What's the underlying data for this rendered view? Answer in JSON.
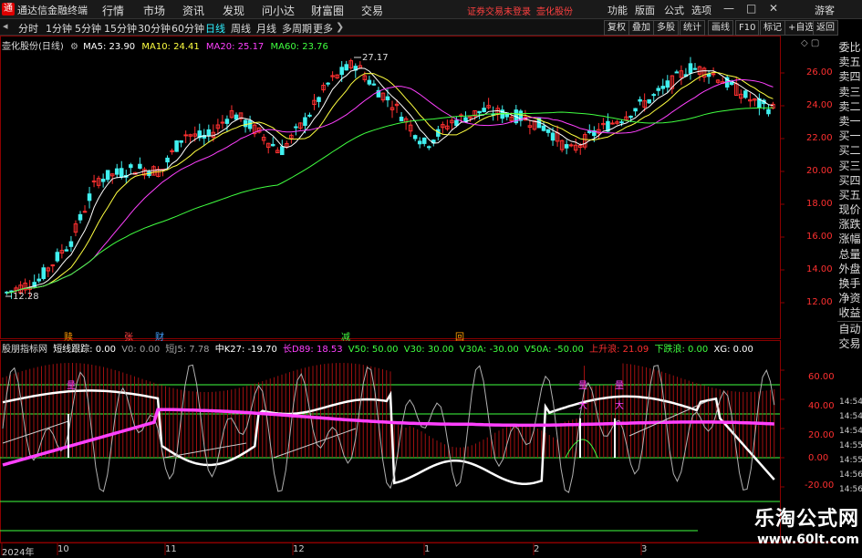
{
  "app": {
    "title": "通达信金融终端",
    "login_warning": "证券交易未登录",
    "stock": "壶化股份",
    "guest": "游客"
  },
  "menu": [
    "行情",
    "市场",
    "资讯",
    "发现",
    "问小达",
    "财富圈",
    "交易"
  ],
  "right_menu": [
    "功能",
    "版面",
    "公式",
    "选项"
  ],
  "toolbar": {
    "periods": [
      "分时",
      "1分钟",
      "5分钟",
      "15分钟",
      "30分钟",
      "60分钟",
      "日线",
      "周线",
      "月线",
      "多周期",
      "更多"
    ],
    "active": "日线"
  },
  "right_toolbar": [
    "复权",
    "叠加",
    "多股",
    "统计",
    "画线",
    "F10",
    "标记",
    "+自选",
    "返回"
  ],
  "main_chart": {
    "title": "壶化股份(日线)",
    "ma": [
      {
        "label": "MA5: 23.90",
        "color": "#ffffff"
      },
      {
        "label": "MA10: 24.41",
        "color": "#ffff40"
      },
      {
        "label": "MA20: 25.17",
        "color": "#ff40ff"
      },
      {
        "label": "MA60: 23.76",
        "color": "#40ff40"
      }
    ],
    "y_ticks": [
      "26.00",
      "24.00",
      "22.00",
      "20.00",
      "18.00",
      "16.00",
      "14.00",
      "12.00"
    ],
    "y_values": [
      26,
      24,
      22,
      20,
      18,
      16,
      14,
      12
    ],
    "high_label": "27.17",
    "low_label": "12.28",
    "events": [
      {
        "text": "赎",
        "color": "#ff9900"
      },
      {
        "text": "张",
        "color": "#ff4040"
      },
      {
        "text": "财",
        "color": "#40a0ff"
      },
      {
        "text": "减",
        "color": "#40ff40"
      },
      {
        "text": "回",
        "color": "#ffa000"
      }
    ]
  },
  "indicator": {
    "name": "股朋指标网",
    "items": [
      {
        "label": "短线跟踪: 0.00",
        "color": "#ffffff"
      },
      {
        "label": "V0: 0.00",
        "color": "#a0a0a0"
      },
      {
        "label": "短J5: 7.78",
        "color": "#a0a0a0"
      },
      {
        "label": "中K27: -19.70",
        "color": "#ffffff"
      },
      {
        "label": "长D89: 18.53",
        "color": "#ff40ff"
      },
      {
        "label": "V50: 50.00",
        "color": "#40ff40"
      },
      {
        "label": "V30: 30.00",
        "color": "#40ff40"
      },
      {
        "label": "V30A: -30.00",
        "color": "#40ff40"
      },
      {
        "label": "V50A: -50.00",
        "color": "#40ff40"
      },
      {
        "label": "上升浪: 21.09",
        "color": "#ff3030"
      },
      {
        "label": "下跌浪: 0.00",
        "color": "#40ff40"
      },
      {
        "label": "XG: 0.00",
        "color": "#ffffff"
      }
    ],
    "y_ticks": [
      "60.00",
      "40.00",
      "20.00",
      "0.00",
      "-20.00"
    ],
    "y_values": [
      60,
      40,
      20,
      0,
      -20
    ],
    "markers": [
      "量",
      "量",
      "大",
      "量",
      "大"
    ]
  },
  "sidebar": [
    "委比",
    "卖五",
    "卖四",
    "卖三",
    "卖二",
    "卖一",
    "买一",
    "买二",
    "买三",
    "买四",
    "买五",
    "现价",
    "涨跌",
    "涨幅",
    "总量",
    "外盘",
    "换手",
    "净资",
    "收益",
    "自动",
    "交易"
  ],
  "times": [
    "14:54",
    "14:54",
    "14:54",
    "14:55",
    "14:55",
    "14:56",
    "14:56"
  ],
  "x_axis": [
    "2024年",
    "10",
    "11",
    "12",
    "1",
    "2",
    "3"
  ],
  "watermark": {
    "title": "乐淘公式网",
    "url": "www.60lt.com"
  }
}
